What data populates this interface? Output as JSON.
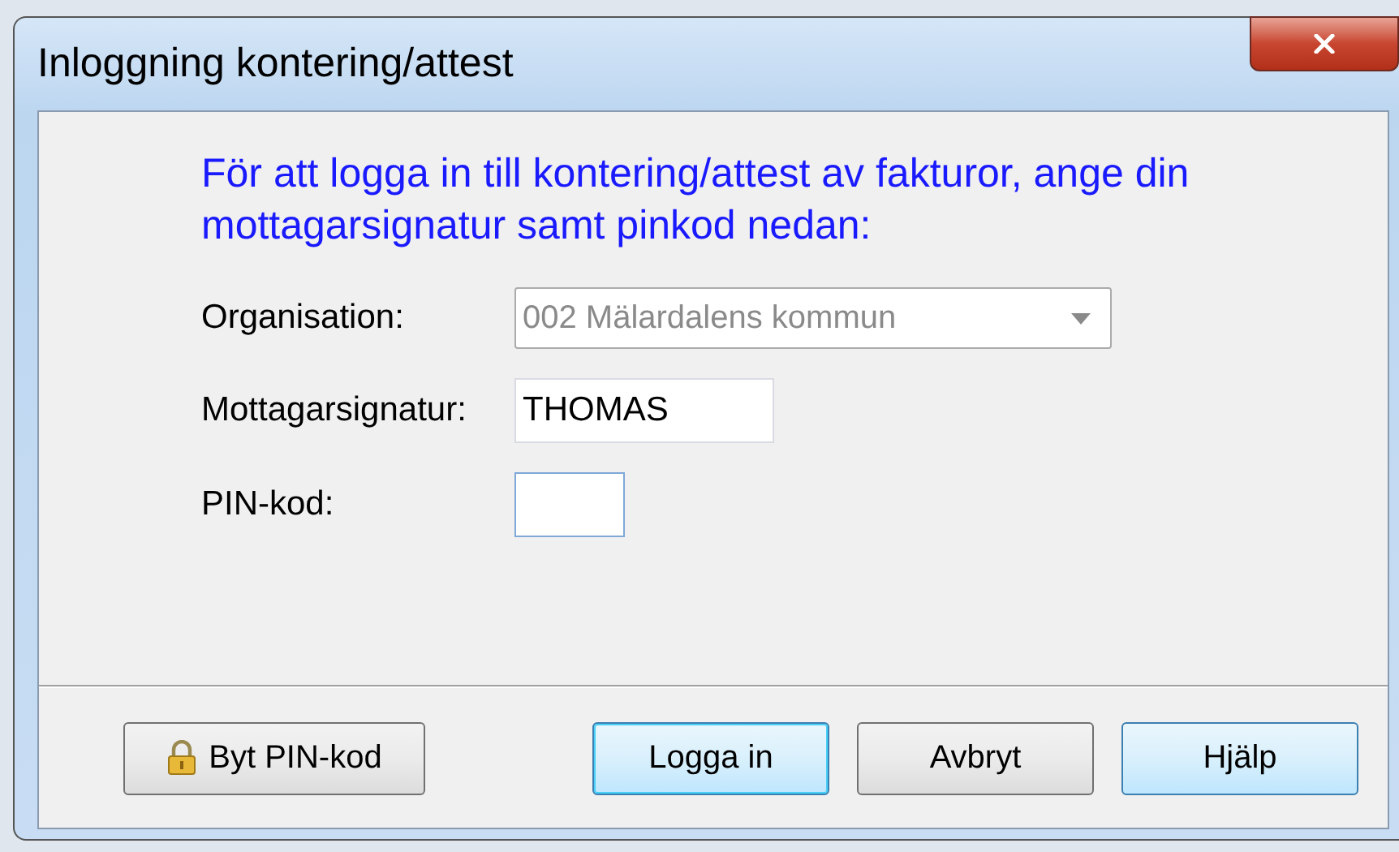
{
  "window": {
    "title": "Inloggning kontering/attest"
  },
  "intro": "För att logga in till kontering/attest av fakturor, ange din mottagarsignatur samt pinkod nedan:",
  "fields": [
    {
      "kind": "dropdown",
      "label": "Organisation:",
      "value": "002 Mälardalens kommun",
      "disabled": true
    },
    {
      "kind": "text",
      "label": "Mottagarsignatur:",
      "value": "THOMAS",
      "disabled": false
    },
    {
      "kind": "pin",
      "label": "PIN-kod:",
      "disabled": false
    }
  ],
  "buttons": [
    {
      "kind": "lock",
      "label": "Byt PIN-kod",
      "focused": false,
      "highlighted": false
    },
    {
      "kind": "plain",
      "label": "Logga in",
      "focused": true,
      "highlighted": true
    },
    {
      "kind": "plain",
      "label": "Avbryt",
      "focused": false,
      "highlighted": false
    },
    {
      "kind": "plain",
      "label": "Hjälp",
      "focused": false,
      "highlighted": true
    }
  ]
}
